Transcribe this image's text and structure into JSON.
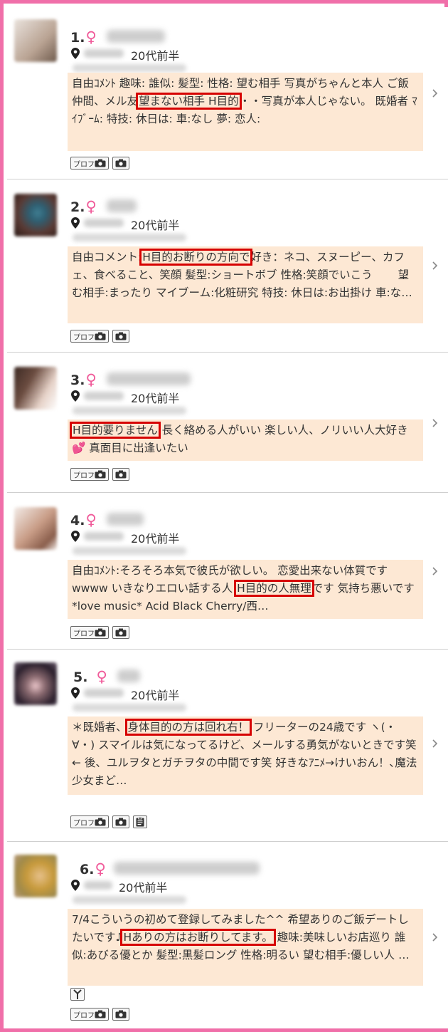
{
  "colors": {
    "frame": "#f06fa9",
    "highlight_border": "#d60000",
    "comment_bg": "#fde8d4",
    "gender": "#f05b9a"
  },
  "badges": {
    "profile_label": "プロフ"
  },
  "cards": [
    {
      "rank": "1.",
      "gender": "♀",
      "age": "20代前半",
      "avatar_colors": [
        "#b9a393",
        "#e9e2dc"
      ],
      "comment": {
        "before": "自由ｺﾒﾝﾄ 趣味: 誰似: 髪型: 性格: 望む相手 写真がちゃんと本人 ご飯仲間、メル友",
        "highlight": "望まない相手 H目的",
        "after": "・・写真が本人じゃない。 既婚者 ﾏｲﾌﾞｰﾑ: 特技: 休日は: 車:なし 夢: 恋人:"
      },
      "icons": [
        "profile-photo",
        "photo"
      ]
    },
    {
      "rank": "2.",
      "gender": "♀",
      "age": "20代前半",
      "avatar_colors": [
        "#5a3a34",
        "#2f5f72"
      ],
      "comment": {
        "before": "自由コメント:",
        "highlight": "H目的お断りの方向で",
        "after": "好き：ネコ、スヌーピー、カフェ、食べること、笑顔 髪型:ショートボブ 性格:笑顔でいこう　　 望む相手:まったり マイブーム:化粧研究 特技: 休日は:お出掛け 車:な…"
      },
      "icons": [
        "profile-photo",
        "photo"
      ]
    },
    {
      "rank": "3.",
      "gender": "♀",
      "age": "20代前半",
      "avatar_colors": [
        "#3c2a24",
        "#e6d2c8"
      ],
      "comment": {
        "before": "",
        "highlight": "H目的要りません",
        "after": "長く絡める人がいい 楽しい人、ノリいい人大好き💕 真面目に出逢いたい"
      },
      "icons": [
        "profile-photo",
        "photo"
      ]
    },
    {
      "rank": "4.",
      "gender": "♀",
      "age": "20代前半",
      "avatar_colors": [
        "#c89c86",
        "#f3ece8"
      ],
      "comment": {
        "before": "自由ｺﾒﾝﾄ:そろそろ本気で彼氏が欲しい。 恋愛出来ない体質ですwwww いきなりエロい話する人",
        "highlight": "H目的の人無理",
        "after": "です 気持ち悪いです *love music* Acid Black Cherry/西…"
      },
      "icons": [
        "profile-photo",
        "photo"
      ]
    },
    {
      "rank": "5.",
      "gender": "♀",
      "age": "20代前半",
      "avatar_colors": [
        "#2a1f2c",
        "#e9c4c8"
      ],
      "comment": {
        "before": "＊既婚者、",
        "highlight": "身体目的の方は回れ右！",
        "after": "フリーターの24歳です ヽ(・∀・) スマイルは気になってるけど、メールする勇気がないときです笑← 後、ユルヲタとガチヲタの中間です笑 好きなｱﾆﾒ→けいおん！､魔法少女まど…"
      },
      "icons": [
        "profile-photo",
        "photo",
        "diary"
      ]
    },
    {
      "rank": "6.",
      "gender": "♀",
      "age": "20代前半",
      "avatar_colors": [
        "#c79a3c",
        "#b89a7a"
      ],
      "comment": {
        "before": "7/4こういうの初めて登録してみました^^ 希望ありのご飯デートしたいです♪",
        "highlight": "Hありの方はお断りしてます。",
        "after": "趣味:美味しいお店巡り 誰似:あびる優とか 髪型:黒髪ロング 性格:明るい 望む相手:優しい人 …"
      },
      "icons": [
        "profile-photo",
        "photo"
      ]
    }
  ]
}
